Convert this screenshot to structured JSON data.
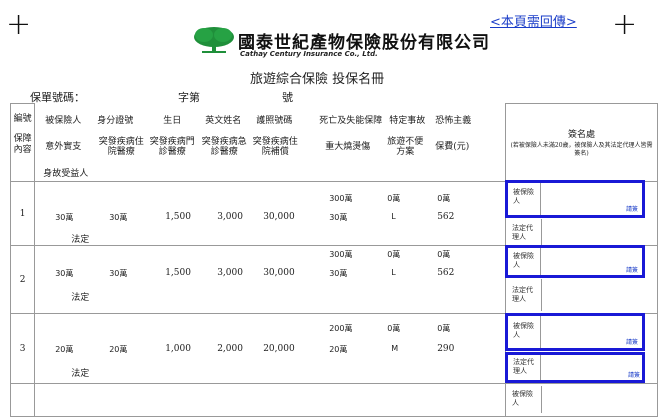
{
  "header": {
    "return_link": "<本頁需回傳>",
    "company_name_zh": "國泰世紀產物保險股份有限公司",
    "company_name_en": "Cathay Century Insurance Co., Ltd.",
    "doc_title": "旅遊綜合保險 投保名冊",
    "policy_label": "保單號碼：",
    "char_label": "字第",
    "number_label": "號"
  },
  "columns": {
    "row1": [
      "編號",
      "被保險人",
      "身分證號",
      "生日",
      "英文姓名",
      "護照號碼",
      "死亡及失能保障",
      "特定事故",
      "恐怖主義"
    ],
    "row2": [
      "保障內容",
      "意外實支",
      "突發疾病住院醫療",
      "突發疾病門診醫療",
      "突發疾病急診醫療",
      "突發疾病住院補償",
      "重大燒燙傷",
      "旅遊不便方案",
      "保費(元)"
    ],
    "row3": "身故受益人",
    "sign_title": "簽名處",
    "sign_note": "(若被保險人未滿20歲，被保險人及其法定代理人皆需簽名)"
  },
  "rows": [
    {
      "no": "1",
      "death": "300萬",
      "special": "0萬",
      "terror": "0萬",
      "accident": "30萬",
      "id_val": "30萬",
      "clinic": "1,500",
      "er": "3,000",
      "hosp": "30,000",
      "burn": "30萬",
      "plan": "L",
      "premium": "562",
      "beneficiary": "法定"
    },
    {
      "no": "2",
      "death": "300萬",
      "special": "0萬",
      "terror": "0萬",
      "accident": "30萬",
      "id_val": "30萬",
      "clinic": "1,500",
      "er": "3,000",
      "hosp": "30,000",
      "burn": "30萬",
      "plan": "L",
      "premium": "562",
      "beneficiary": "法定"
    },
    {
      "no": "3",
      "death": "200萬",
      "special": "0萬",
      "terror": "0萬",
      "accident": "20萬",
      "id_val": "20萬",
      "clinic": "1,000",
      "er": "2,000",
      "hosp": "20,000",
      "burn": "20萬",
      "plan": "M",
      "premium": "290",
      "beneficiary": "法定"
    }
  ],
  "sign": {
    "insured_label": "被保險人",
    "guardian_label": "法定代理人",
    "sign_button": "請簽"
  },
  "colors": {
    "sign_box": "#1919d6",
    "logo_green": "#1f8f3a",
    "link_blue": "#1a3cc8"
  }
}
